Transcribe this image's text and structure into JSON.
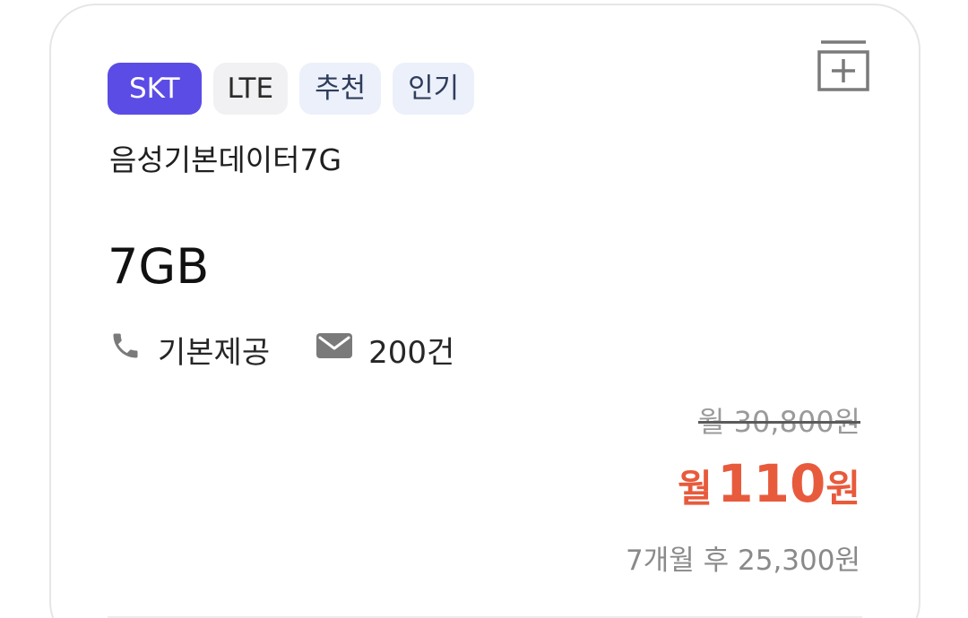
{
  "tags": {
    "carrier": "SKT",
    "network": "LTE",
    "feature_1": "추천",
    "feature_2": "인기"
  },
  "plan": {
    "name": "음성기본데이터7G",
    "data": "7GB",
    "call": "기본제공",
    "sms": "200건"
  },
  "price": {
    "original": "월 30,800원",
    "discount_prefix": "월",
    "discount_amount": "110",
    "discount_unit": "원",
    "after": "7개월 후 25,300원"
  },
  "icons": {
    "compare": "add-to-compare-icon",
    "call": "phone-icon",
    "sms": "mail-icon"
  },
  "colors": {
    "carrier_tag": "#5b4ce6",
    "discount_price": "#e85a3c"
  }
}
